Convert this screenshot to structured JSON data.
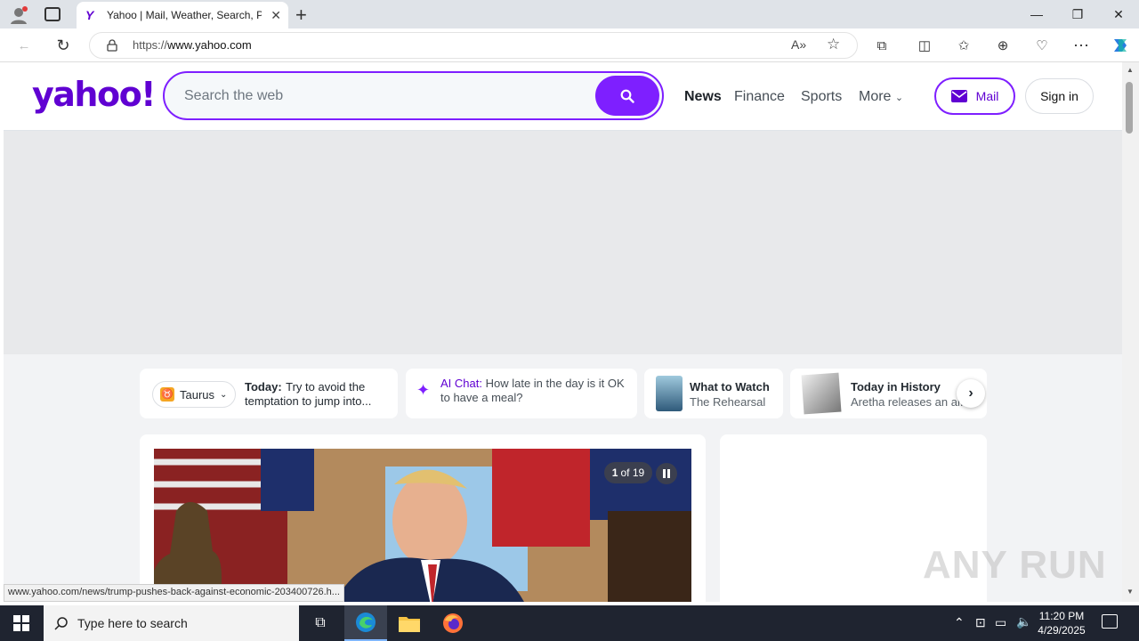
{
  "browser": {
    "tab_title": "Yahoo | Mail, Weather, Search, Politics, News, Finance, Sports & Videos",
    "tab_favicon": "Y",
    "url_prefix": "https://",
    "url_host": "www.yahoo.com",
    "status_url": "www.yahoo.com/news/trump-pushes-back-against-economic-203400726.h..."
  },
  "yahoo": {
    "logo": "yahoo!",
    "search_placeholder": "Search the web",
    "nav": [
      "News",
      "Finance",
      "Sports",
      "More"
    ],
    "mail_label": "Mail",
    "signin_label": "Sign in",
    "brand_color": "#6001d2",
    "accent_color": "#7e1fff"
  },
  "cards": {
    "horoscope_sign": "Taurus",
    "horoscope_label": "Today:",
    "horoscope_text": "Try to avoid the temptation to jump into...",
    "aichat_label": "AI Chat:",
    "aichat_text": "How late in the day is it OK to have a meal?",
    "watch_title": "What to Watch",
    "watch_sub": "The Rehearsal",
    "history_title": "Today in History",
    "history_sub": "Aretha releases an al..."
  },
  "story": {
    "counter_current": "1",
    "counter_total": "of 19"
  },
  "taskbar": {
    "search_placeholder": "Type here to search",
    "time": "11:20 PM",
    "date": "4/29/2025"
  },
  "watermark": "ANY RUN"
}
